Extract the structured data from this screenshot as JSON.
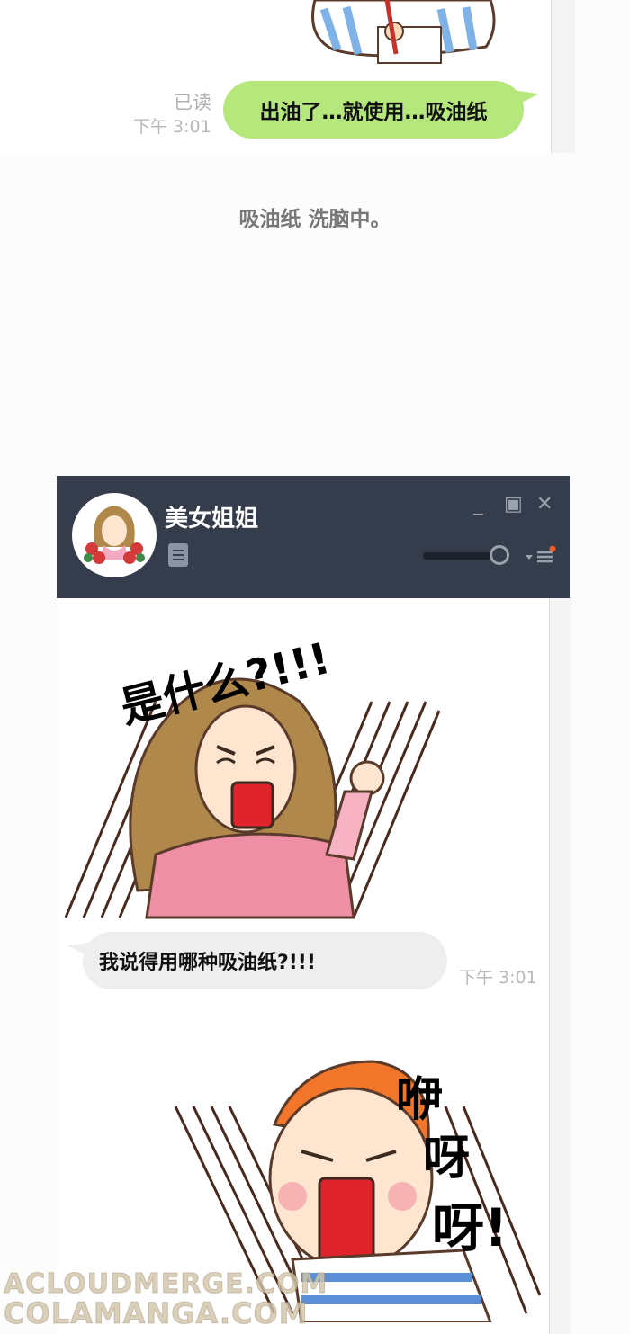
{
  "top_chat": {
    "read_status": "已读",
    "time": "下午 3:01",
    "sent_message": "出油了…就使用…吸油纸"
  },
  "narration": "吸油纸 洗脑中。",
  "chat_window": {
    "contact_name": "美女姐姐",
    "icons": [
      "minimize-icon",
      "maximize-icon",
      "close-icon",
      "notes-icon",
      "volume-slider",
      "menu-icon"
    ],
    "controls": {
      "minimize": "_",
      "maximize": "▣",
      "close": "✕"
    },
    "sticker_1_text": "是什么?!!!",
    "received_message": "我说得用哪种吸油纸?!!!",
    "received_time": "下午 3:01",
    "sticker_2_text": [
      "咿",
      "呀",
      "呀!"
    ]
  },
  "watermark": {
    "line1": "ACLOUDMERGE.COM",
    "line2": "COLAMANGA.COM"
  },
  "colors": {
    "header": "#353c4c",
    "sent_bubble": "#b5e77c",
    "received_bubble": "#eeeeee"
  }
}
